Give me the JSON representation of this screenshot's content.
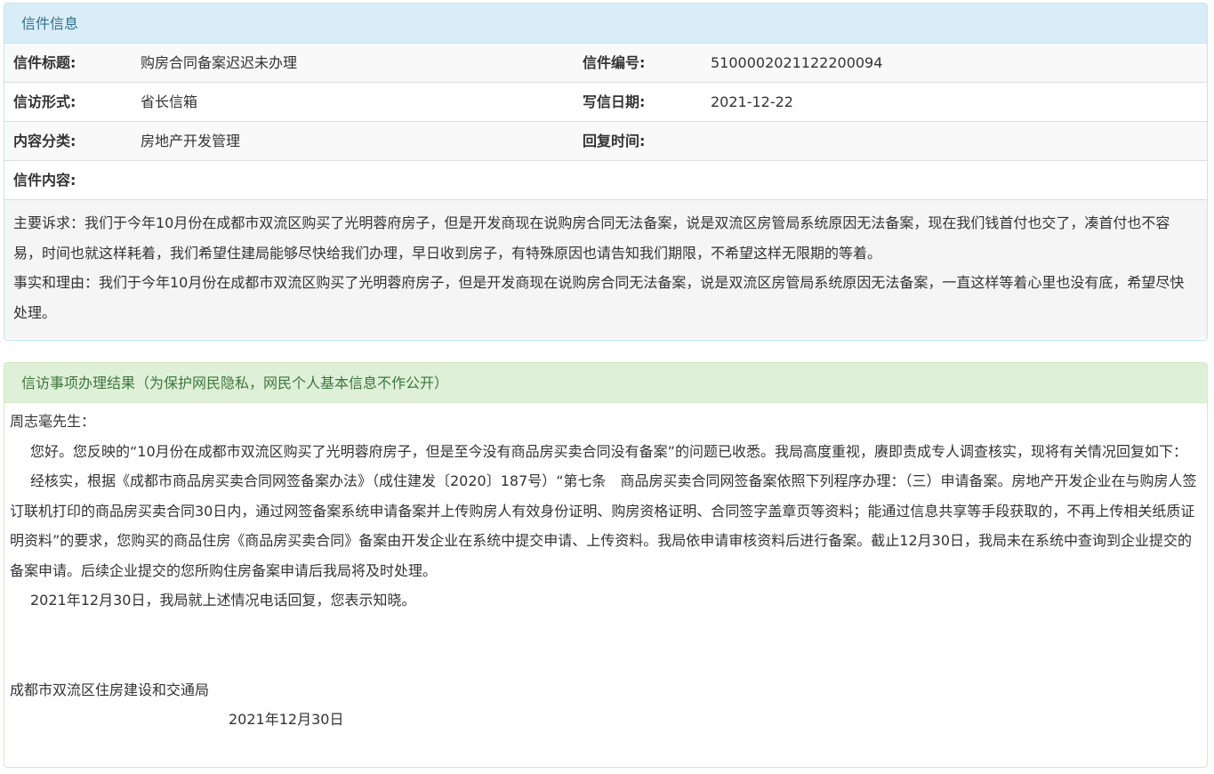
{
  "letter_panel": {
    "heading": "信件信息",
    "rows": [
      {
        "label1": "信件标题:",
        "value1": "购房合同备案迟迟未办理",
        "label2": "信件编号:",
        "value2": "5100002021122200094"
      },
      {
        "label1": "信访形式:",
        "value1": "省长信箱",
        "label2": "写信日期:",
        "value2": "2021-12-22"
      },
      {
        "label1": "内容分类:",
        "value1": "房地产开发管理",
        "label2": "回复时间:",
        "value2": ""
      }
    ],
    "content_label": "信件内容:",
    "content_paragraphs": [
      "主要诉求：我们于今年10月份在成都市双流区购买了光明蓉府房子，但是开发商现在说购房合同无法备案，说是双流区房管局系统原因无法备案，现在我们钱首付也交了，凑首付也不容易，时间也就这样耗着，我们希望住建局能够尽快给我们办理，早日收到房子，有特殊原因也请告知我们期限，不希望这样无限期的等着。",
      "事实和理由：我们于今年10月份在成都市双流区购买了光明蓉府房子，但是开发商现在说购房合同无法备案，说是双流区房管局系统原因无法备案，一直这样等着心里也没有底，希望尽快处理。"
    ]
  },
  "result_panel": {
    "heading": "信访事项办理结果（为保护网民隐私，网民个人基本信息不作公开）",
    "salutation": "周志毫先生：",
    "paragraphs": [
      "您好。您反映的“10月份在成都市双流区购买了光明蓉府房子，但是至今没有商品房买卖合同没有备案”的问题已收悉。我局高度重视，赓即责成专人调查核实，现将有关情况回复如下：",
      "经核实，根据《成都市商品房买卖合同网签备案办法》（成住建发〔2020〕187号）“第七条　商品房买卖合同网签备案依照下列程序办理：（三）申请备案。房地产开发企业在与购房人签订联机打印的商品房买卖合同30日内，通过网签备案系统申请备案并上传购房人有效身份证明、购房资格证明、合同签字盖章页等资料；能通过信息共享等手段获取的，不再上传相关纸质证明资料”的要求，您购买的商品住房《商品房买卖合同》备案由开发企业在系统中提交申请、上传资料。我局依申请审核资料后进行备案。截止12月30日，我局未在系统中查询到企业提交的备案申请。后续企业提交的您所购住房备案申请后我局将及时处理。",
      "2021年12月30日，我局就上述情况电话回复，您表示知晓。"
    ],
    "signature": "成都市双流区住房建设和交通局",
    "date": "2021年12月30日"
  }
}
